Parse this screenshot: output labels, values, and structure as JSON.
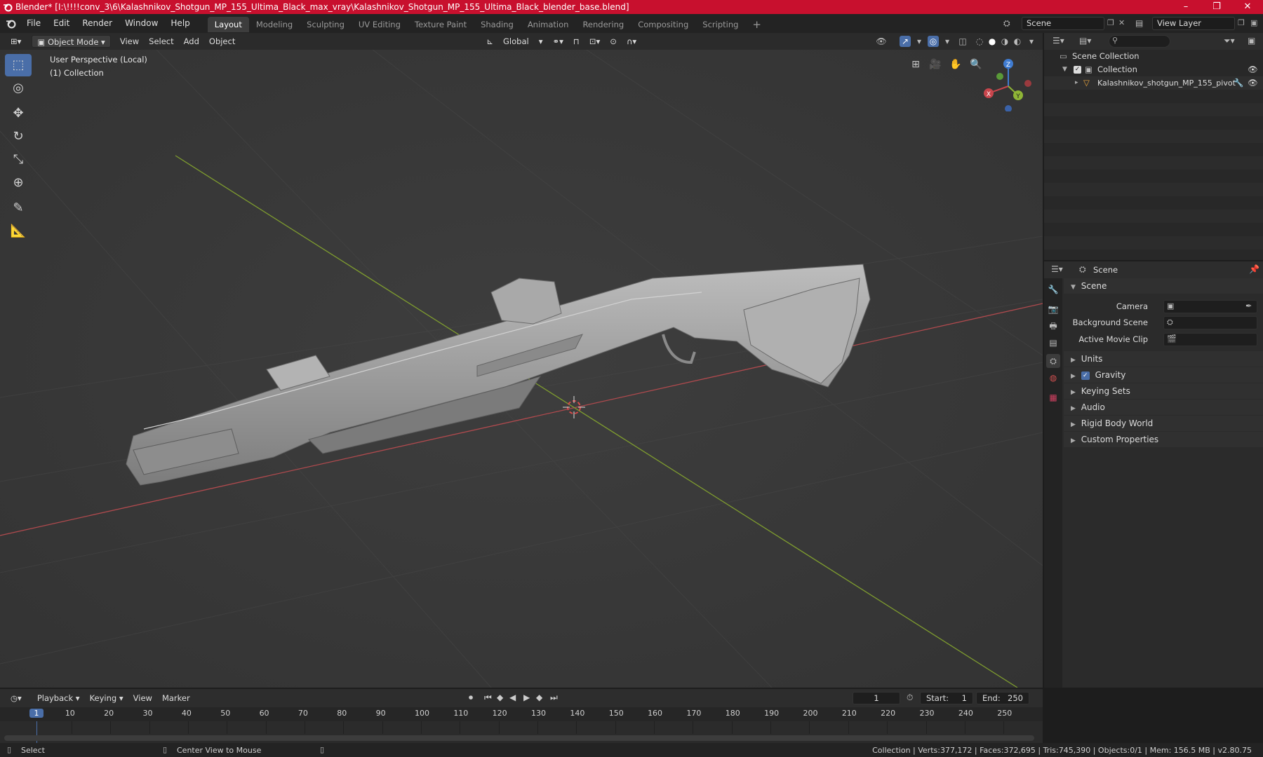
{
  "titlebar": {
    "title": "Blender* [I:\\!!!!conv_3\\6\\Kalashnikov_Shotgun_MP_155_Ultima_Black_max_vray\\Kalashnikov_Shotgun_MP_155_Ultima_Black_blender_base.blend]",
    "minimize": "–",
    "maximize": "❐",
    "close": "✕"
  },
  "menu": [
    "File",
    "Edit",
    "Render",
    "Window",
    "Help"
  ],
  "workspaces": [
    "Layout",
    "Modeling",
    "Sculpting",
    "UV Editing",
    "Texture Paint",
    "Shading",
    "Animation",
    "Rendering",
    "Compositing",
    "Scripting"
  ],
  "add_workspace": "+",
  "scene_name": "Scene",
  "view_layer": "View Layer",
  "viewport": {
    "mode": "Object Mode",
    "menus": [
      "View",
      "Select",
      "Add",
      "Object"
    ],
    "orientation": "Global",
    "perspective_label": "User Perspective (Local)",
    "collection_label": "(1) Collection",
    "gizmo": {
      "x": "X",
      "y": "Y",
      "z": "Z"
    }
  },
  "outliner": {
    "search_placeholder": "",
    "rows": [
      {
        "label": "Scene Collection"
      },
      {
        "label": "Collection"
      },
      {
        "label": "Kalashnikov_shotgun_MP_155_pivot"
      }
    ]
  },
  "properties": {
    "context": "Scene",
    "section": "Scene",
    "fields": [
      {
        "label": "Camera"
      },
      {
        "label": "Background Scene"
      },
      {
        "label": "Active Movie Clip"
      }
    ],
    "panels": [
      "Units",
      "Gravity",
      "Keying Sets",
      "Audio",
      "Rigid Body World",
      "Custom Properties"
    ]
  },
  "timeline": {
    "menus": [
      "Playback",
      "Keying",
      "View",
      "Marker"
    ],
    "current_frame": "1",
    "start_label": "Start:",
    "start": "1",
    "end_label": "End:",
    "end": "250",
    "ticks": [
      "1",
      "10",
      "20",
      "30",
      "40",
      "50",
      "60",
      "70",
      "80",
      "90",
      "100",
      "110",
      "120",
      "130",
      "140",
      "150",
      "160",
      "170",
      "180",
      "190",
      "200",
      "210",
      "220",
      "230",
      "240",
      "250"
    ]
  },
  "statusbar": {
    "left": "Select",
    "middle": "Center View to Mouse",
    "right": "Collection | Verts:377,172 | Faces:372,695 | Tris:745,390 | Objects:0/1 | Mem: 156.5 MB | v2.80.75"
  },
  "colors": {
    "titlebar": "#c8102e",
    "accent": "#4a6ea8",
    "x_axis": "#c8454c",
    "y_axis": "#8fb536",
    "z_axis": "#3f7bd0"
  }
}
